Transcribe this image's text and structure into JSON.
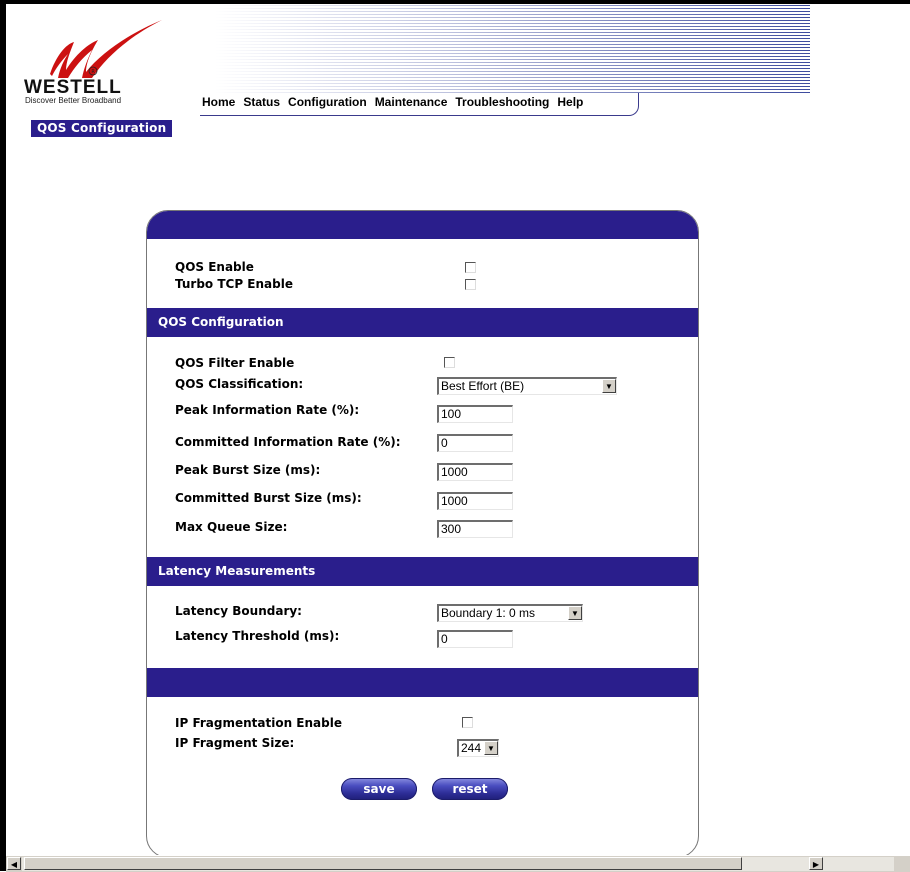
{
  "brand": {
    "name": "WESTELL",
    "tagline": "Discover Better Broadband",
    "accent": "#2a1e8c",
    "logo_red": "#cc1111"
  },
  "nav": {
    "items": [
      "Home",
      "Status",
      "Configuration",
      "Maintenance",
      "Troubleshooting",
      "Help"
    ]
  },
  "page_tab": "QOS Configuration",
  "general": {
    "qos_enable_label": "QOS Enable",
    "turbo_tcp_label": "Turbo TCP Enable"
  },
  "qos_section": {
    "title": "QOS Configuration",
    "filter_enable_label": "QOS Filter Enable",
    "classification_label": "QOS Classification:",
    "classification_value": "Best Effort (BE)",
    "pir_label": "Peak Information Rate (%):",
    "pir_value": "100",
    "cir_label": "Committed Information Rate (%):",
    "cir_value": "0",
    "pbs_label": "Peak Burst Size (ms):",
    "pbs_value": "1000",
    "cbs_label": "Committed Burst Size (ms):",
    "cbs_value": "1000",
    "mqs_label": "Max Queue Size:",
    "mqs_value": "300"
  },
  "latency_section": {
    "title": "Latency Measurements",
    "boundary_label": "Latency Boundary:",
    "boundary_value": "Boundary 1: 0 ms",
    "threshold_label": "Latency Threshold (ms):",
    "threshold_value": "0"
  },
  "fragment_section": {
    "title": "",
    "enable_label": "IP Fragmentation Enable",
    "size_label": "IP Fragment Size:",
    "size_value": "244"
  },
  "buttons": {
    "save": "save",
    "reset": "reset"
  },
  "icons": {
    "dropdown": "chevron-down-icon",
    "scroll_left": "arrow-left-icon",
    "scroll_right": "arrow-right-icon"
  }
}
